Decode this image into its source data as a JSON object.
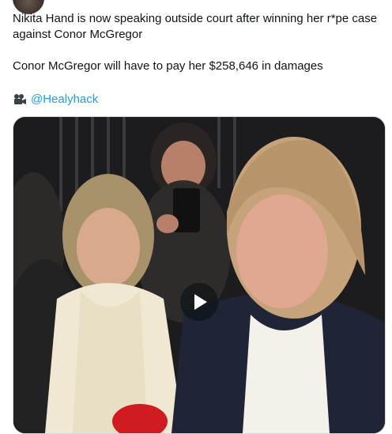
{
  "tweet": {
    "line1": "Nikita Hand is now speaking outside court after winning her r*pe case against Conor McGregor",
    "line2": "Conor McGregor will have to pay her $258,646 in damages",
    "credit_icon": "video-camera-icon",
    "credit_handle": "@Healyhack"
  },
  "media": {
    "type": "video",
    "play_icon": "play-icon"
  },
  "colors": {
    "text": "#0f1419",
    "link": "#1d9bf0",
    "border": "#cfd9de"
  }
}
